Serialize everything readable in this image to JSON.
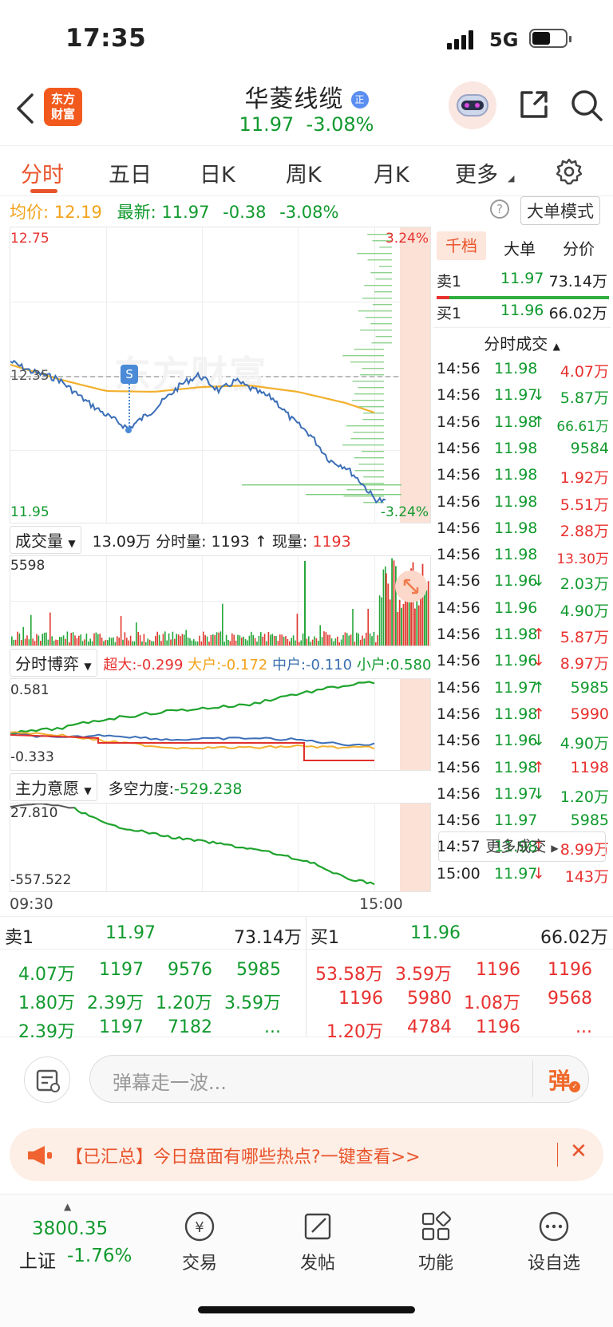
{
  "status_bar": {
    "time": "17:35",
    "network": "5G"
  },
  "header": {
    "logo_text": "东方\n财富",
    "stock_name": "华菱线缆",
    "badge": "正",
    "price": "11.97",
    "change_pct": "-3.08%"
  },
  "tabs": [
    {
      "label": "分时",
      "active": true
    },
    {
      "label": "五日"
    },
    {
      "label": "日K"
    },
    {
      "label": "周K"
    },
    {
      "label": "月K"
    },
    {
      "label": "更多"
    }
  ],
  "info_line": {
    "avg_label": "均价:",
    "avg_value": "12.19",
    "latest_label": "最新:",
    "latest_value": "11.97",
    "change": "-0.38",
    "change_pct": "-3.08%",
    "mode_button": "大单模式"
  },
  "price_chart": {
    "y_max": "12.75",
    "y_min": "11.95",
    "ref_price": "12.35",
    "pct_max": "3.24%",
    "pct_min": "-3.24%",
    "marker": "S",
    "watermark": "东方财富"
  },
  "volume_panel": {
    "dropdown": "成交量",
    "total": "13.09万",
    "minute_label": "分时量:",
    "minute_value": "1193",
    "arrow": "↑",
    "now_label": "现量:",
    "now_value": "1193",
    "y_max": "5598"
  },
  "game_panel": {
    "dropdown": "分时博弈",
    "super_large": "超大:-0.299",
    "large": "大户:-0.172",
    "medium": "中户:-0.110",
    "small": "小户:0.580",
    "y_max": "0.581",
    "y_min": "-0.333"
  },
  "intent_panel": {
    "dropdown": "主力意愿",
    "strength_label": "多空力度:",
    "strength_value": "-529.238",
    "y_max": "27.810",
    "y_min": "-557.522",
    "time_start": "09:30",
    "time_end": "15:00"
  },
  "order_book": {
    "tabs": [
      "千档",
      "大单",
      "分价"
    ],
    "sell1": {
      "label": "卖1",
      "price": "11.97",
      "vol": "73.14万"
    },
    "buy1": {
      "label": "买1",
      "price": "11.96",
      "vol": "66.02万"
    },
    "section_title": "分时成交",
    "trades": [
      {
        "time": "14:56",
        "price": "11.98",
        "arrow": "",
        "vol": "4.07万",
        "color": "red"
      },
      {
        "time": "14:56",
        "price": "11.97",
        "arrow": "↓",
        "vol": "5.87万",
        "color": "green"
      },
      {
        "time": "14:56",
        "price": "11.98",
        "arrow": "↑",
        "vol": "66.61万",
        "color": "green"
      },
      {
        "time": "14:56",
        "price": "11.98",
        "arrow": "",
        "vol": "9584",
        "color": "green"
      },
      {
        "time": "14:56",
        "price": "11.98",
        "arrow": "",
        "vol": "1.92万",
        "color": "red"
      },
      {
        "time": "14:56",
        "price": "11.98",
        "arrow": "",
        "vol": "5.51万",
        "color": "red"
      },
      {
        "time": "14:56",
        "price": "11.98",
        "arrow": "",
        "vol": "2.88万",
        "color": "red"
      },
      {
        "time": "14:56",
        "price": "11.98",
        "arrow": "",
        "vol": "13.30万",
        "color": "red"
      },
      {
        "time": "14:56",
        "price": "11.96",
        "arrow": "↓",
        "vol": "2.03万",
        "color": "green"
      },
      {
        "time": "14:56",
        "price": "11.96",
        "arrow": "",
        "vol": "4.90万",
        "color": "green"
      },
      {
        "time": "14:56",
        "price": "11.98",
        "arrow": "↑",
        "vol": "5.87万",
        "color": "red"
      },
      {
        "time": "14:56",
        "price": "11.96",
        "arrow": "↓",
        "vol": "8.97万",
        "color": "red"
      },
      {
        "time": "14:56",
        "price": "11.97",
        "arrow": "↑",
        "vol": "5985",
        "color": "green"
      },
      {
        "time": "14:56",
        "price": "11.98",
        "arrow": "↑",
        "vol": "5990",
        "color": "red"
      },
      {
        "time": "14:56",
        "price": "11.96",
        "arrow": "↓",
        "vol": "4.90万",
        "color": "green"
      },
      {
        "time": "14:56",
        "price": "11.98",
        "arrow": "↑",
        "vol": "1198",
        "color": "red"
      },
      {
        "time": "14:56",
        "price": "11.97",
        "arrow": "↓",
        "vol": "1.20万",
        "color": "green"
      },
      {
        "time": "14:56",
        "price": "11.97",
        "arrow": "",
        "vol": "5985",
        "color": "green"
      },
      {
        "time": "14:57",
        "price": "11.98",
        "arrow": "↑",
        "vol": "8.99万",
        "color": "red"
      },
      {
        "time": "15:00",
        "price": "11.97",
        "arrow": "↓",
        "vol": "143万",
        "color": "red"
      }
    ],
    "more_button": "更多成交"
  },
  "depth": {
    "sell_label": "卖1",
    "sell_price": "11.97",
    "sell_vol": "73.14万",
    "buy_label": "买1",
    "buy_price": "11.96",
    "buy_vol": "66.02万",
    "sell_rows": [
      [
        "4.07万",
        "1197",
        "9576",
        "5985"
      ],
      [
        "1.80万",
        "2.39万",
        "1.20万",
        "3.59万"
      ],
      [
        "2.39万",
        "1197",
        "7182",
        "..."
      ]
    ],
    "buy_rows": [
      [
        "53.58万",
        "3.59万",
        "1196",
        "1196"
      ],
      [
        "1196",
        "5980",
        "1.08万",
        "9568"
      ],
      [
        "1.20万",
        "4784",
        "1196",
        "..."
      ]
    ]
  },
  "comment": {
    "placeholder": "弹幕走一波...",
    "danmu_label": "弹"
  },
  "banner": {
    "text": "【已汇总】今日盘面有哪些热点?一键查看>>"
  },
  "bottom_bar": {
    "index_value": "3800.35",
    "index_name": "上证",
    "index_change": "-1.76%",
    "items": [
      "交易",
      "发帖",
      "功能",
      "设自选"
    ]
  }
}
